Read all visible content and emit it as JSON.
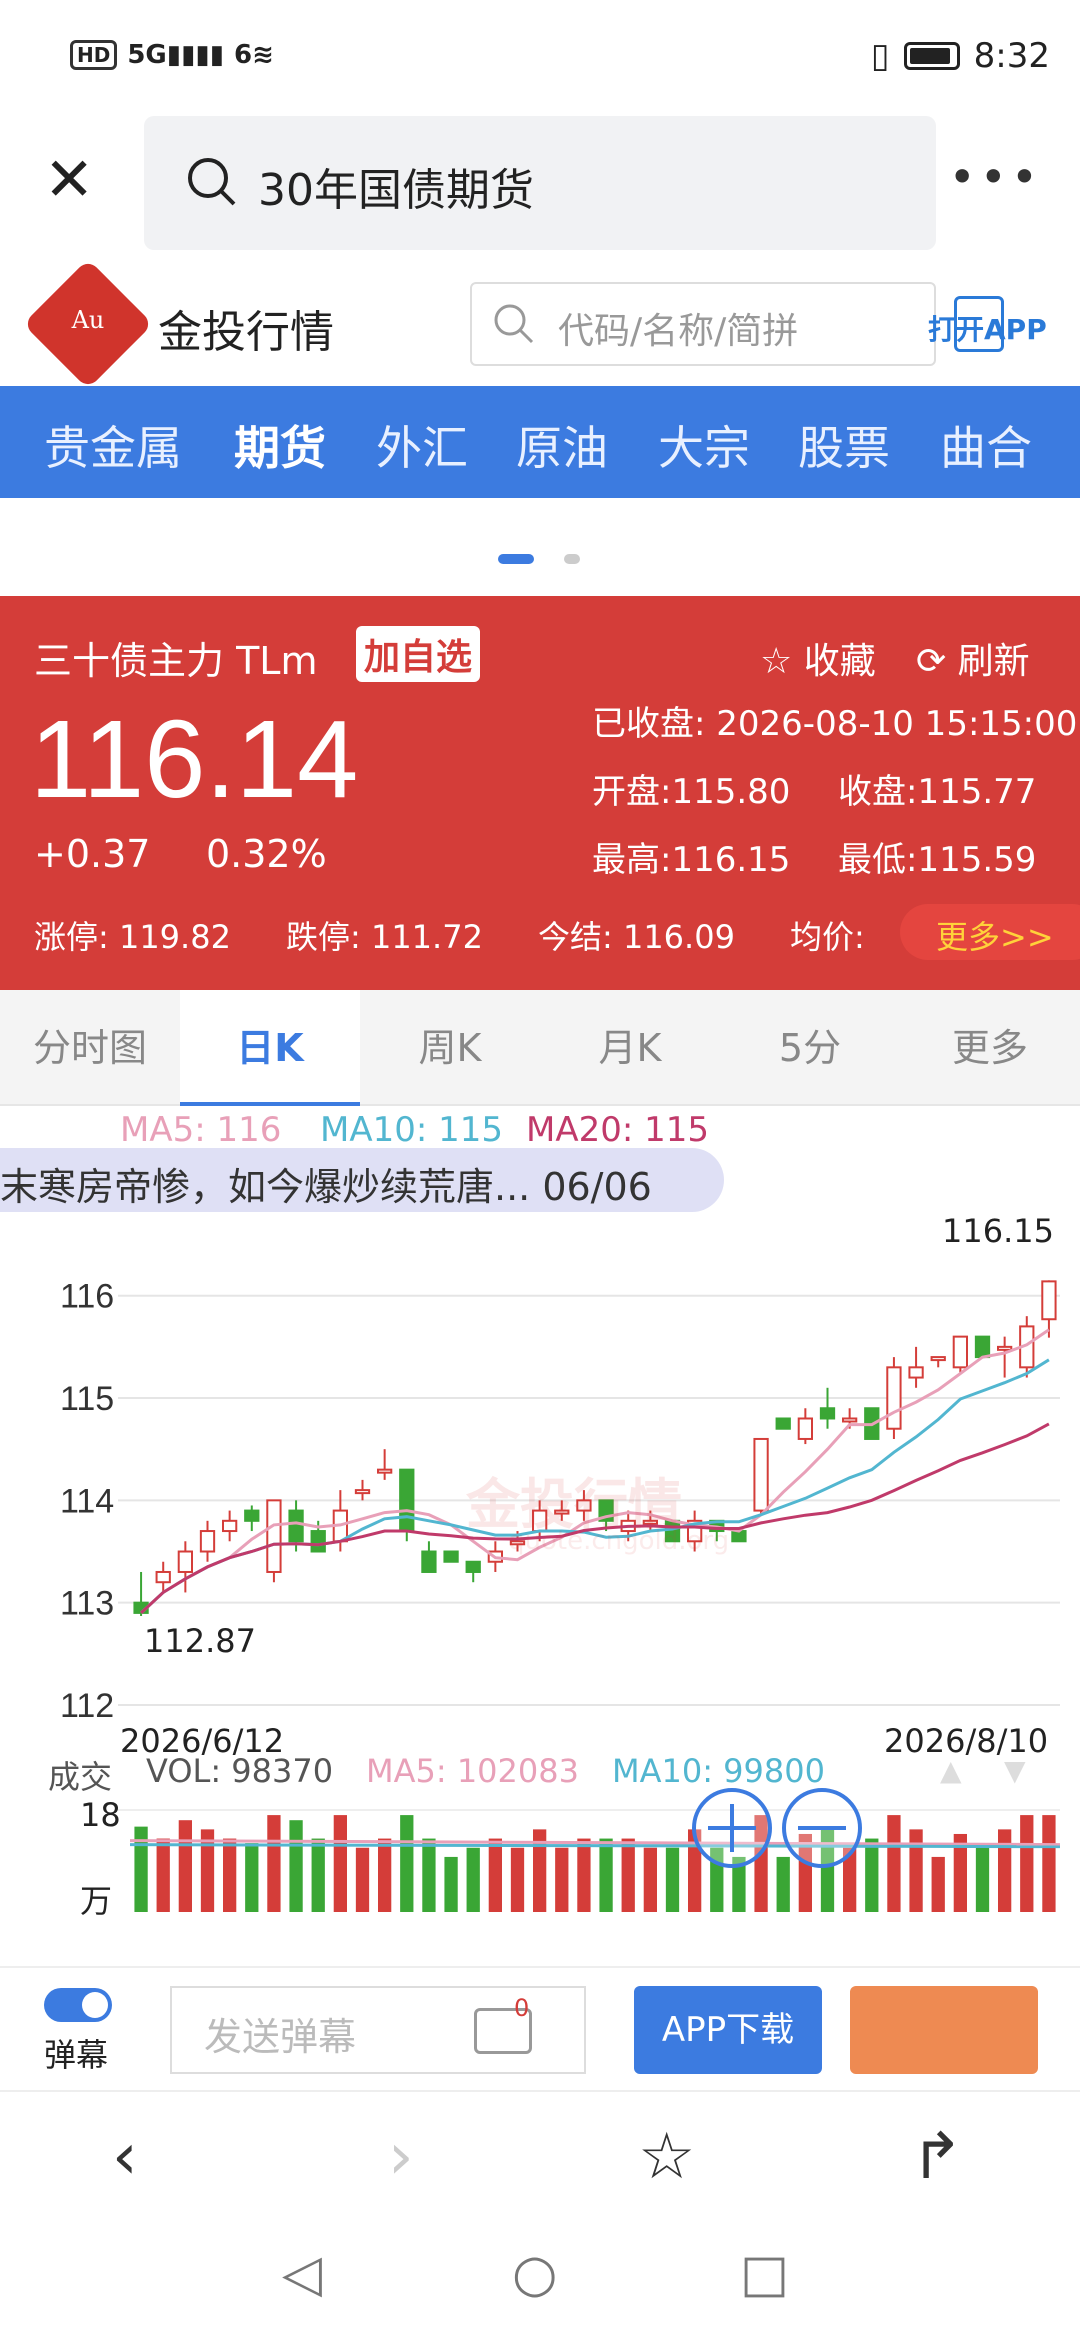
{
  "status_bar": {
    "left_icons": [
      "hd-icon",
      "5g-signal-icon",
      "6-wifi-icon"
    ],
    "hd": "HD",
    "network": "5G",
    "wifi": "6",
    "time": "8:32"
  },
  "browser": {
    "search_query": "30年国债期货"
  },
  "site": {
    "logo_text": "Au",
    "brand": "金投行情",
    "search_placeholder": "代码/名称/简拼",
    "open_app": "打开APP"
  },
  "nav": {
    "items": [
      {
        "label": "贵金属"
      },
      {
        "label": "期货"
      },
      {
        "label": "外汇"
      },
      {
        "label": "原油"
      },
      {
        "label": "大宗"
      },
      {
        "label": "股票"
      },
      {
        "label": "曲合"
      }
    ],
    "active_index": 1
  },
  "quote": {
    "name": "三十债主力 TLm",
    "add_watch": "加自选",
    "favorite": "收藏",
    "refresh": "刷新",
    "price": "116.14",
    "change": "+0.37",
    "change_pct": "0.32%",
    "status": "已收盘:",
    "datetime": "2026-08-10 15:15:00",
    "open": "开盘:115.80",
    "close": "收盘:115.77",
    "high": "最高:116.15",
    "low": "最低:115.59",
    "limit_up": "涨停: 119.82",
    "limit_down": "跌停: 111.72",
    "settle": "今结: 116.09",
    "avg": "均价:",
    "more": "更多>>",
    "colors": {
      "panel": "#d43d39",
      "more": "#ffd23a"
    }
  },
  "tabs": [
    {
      "label": "分时图"
    },
    {
      "label": "日K"
    },
    {
      "label": "周K"
    },
    {
      "label": "月K"
    },
    {
      "label": "5分"
    },
    {
      "label": "更多"
    }
  ],
  "chart": {
    "ma5_label": "MA5: 116",
    "ma10_label": "MA10: 115",
    "ma20_label": "MA20: 115",
    "danmaku": "末寒房帝惨，如今爆炒续荒唐... 06/06",
    "high_label": "116.15",
    "low_label": "112.87",
    "y_ticks": [
      "116",
      "115",
      "114",
      "113",
      "112"
    ],
    "start_date": "2026/6/12",
    "end_date": "2026/8/10",
    "watermark": "金投行情",
    "watermark_url": "quote.cngold.org",
    "vol_title": "成交",
    "vol_label": "VOL: 98370",
    "vol_ma5_label": "MA5: 102083",
    "vol_ma10_label": "MA10: 99800",
    "vol_axis_top": "18",
    "vol_axis_unit": "万",
    "colors": {
      "up": "#d43d39",
      "down": "#3aa635",
      "ma5": "#e8a0b8",
      "ma10": "#52b6d0",
      "ma20": "#c03a6a"
    }
  },
  "chart_data": {
    "type": "candlestick",
    "x": [
      "2026/6/12",
      "2026/8/10"
    ],
    "ylim": [
      112,
      116.3
    ],
    "candles": [
      [
        113.0,
        113.3,
        112.87,
        112.9
      ],
      [
        113.2,
        113.4,
        113.1,
        113.3
      ],
      [
        113.3,
        113.6,
        113.1,
        113.5
      ],
      [
        113.5,
        113.8,
        113.4,
        113.7
      ],
      [
        113.7,
        113.9,
        113.6,
        113.8
      ],
      [
        113.9,
        113.95,
        113.7,
        113.8
      ],
      [
        113.3,
        114.0,
        113.2,
        114.0
      ],
      [
        113.9,
        114.0,
        113.5,
        113.6
      ],
      [
        113.7,
        113.8,
        113.5,
        113.5
      ],
      [
        113.6,
        114.1,
        113.5,
        113.9
      ],
      [
        114.1,
        114.2,
        114.0,
        114.1
      ],
      [
        114.3,
        114.5,
        114.2,
        114.3
      ],
      [
        114.3,
        114.3,
        113.6,
        113.7
      ],
      [
        113.5,
        113.6,
        113.3,
        113.3
      ],
      [
        113.5,
        113.5,
        113.4,
        113.4
      ],
      [
        113.4,
        113.4,
        113.2,
        113.3
      ],
      [
        113.4,
        113.6,
        113.3,
        113.5
      ],
      [
        113.6,
        113.7,
        113.5,
        113.6
      ],
      [
        113.7,
        114.0,
        113.6,
        113.9
      ],
      [
        113.9,
        114.0,
        113.8,
        113.9
      ],
      [
        113.9,
        114.1,
        113.8,
        114.0
      ],
      [
        114.0,
        114.0,
        113.7,
        113.8
      ],
      [
        113.7,
        113.9,
        113.6,
        113.8
      ],
      [
        113.8,
        113.9,
        113.7,
        113.8
      ],
      [
        113.8,
        113.8,
        113.6,
        113.6
      ],
      [
        113.6,
        113.9,
        113.5,
        113.8
      ],
      [
        113.8,
        113.8,
        113.6,
        113.7
      ],
      [
        113.7,
        113.7,
        113.6,
        113.6
      ],
      [
        113.9,
        114.6,
        113.85,
        114.6
      ],
      [
        114.8,
        114.8,
        114.7,
        114.7
      ],
      [
        114.6,
        114.9,
        114.55,
        114.8
      ],
      [
        114.9,
        115.1,
        114.7,
        114.8
      ],
      [
        114.8,
        114.9,
        114.7,
        114.8
      ],
      [
        114.9,
        114.9,
        114.6,
        114.6
      ],
      [
        114.7,
        115.4,
        114.6,
        115.3
      ],
      [
        115.2,
        115.5,
        115.1,
        115.3
      ],
      [
        115.4,
        115.4,
        115.3,
        115.4
      ],
      [
        115.3,
        115.6,
        115.25,
        115.6
      ],
      [
        115.6,
        115.6,
        115.4,
        115.4
      ],
      [
        115.5,
        115.6,
        115.2,
        115.5
      ],
      [
        115.3,
        115.8,
        115.2,
        115.7
      ],
      [
        115.77,
        116.15,
        115.59,
        116.14
      ]
    ],
    "volume_range_wan": [
      0,
      18
    ]
  }
}
